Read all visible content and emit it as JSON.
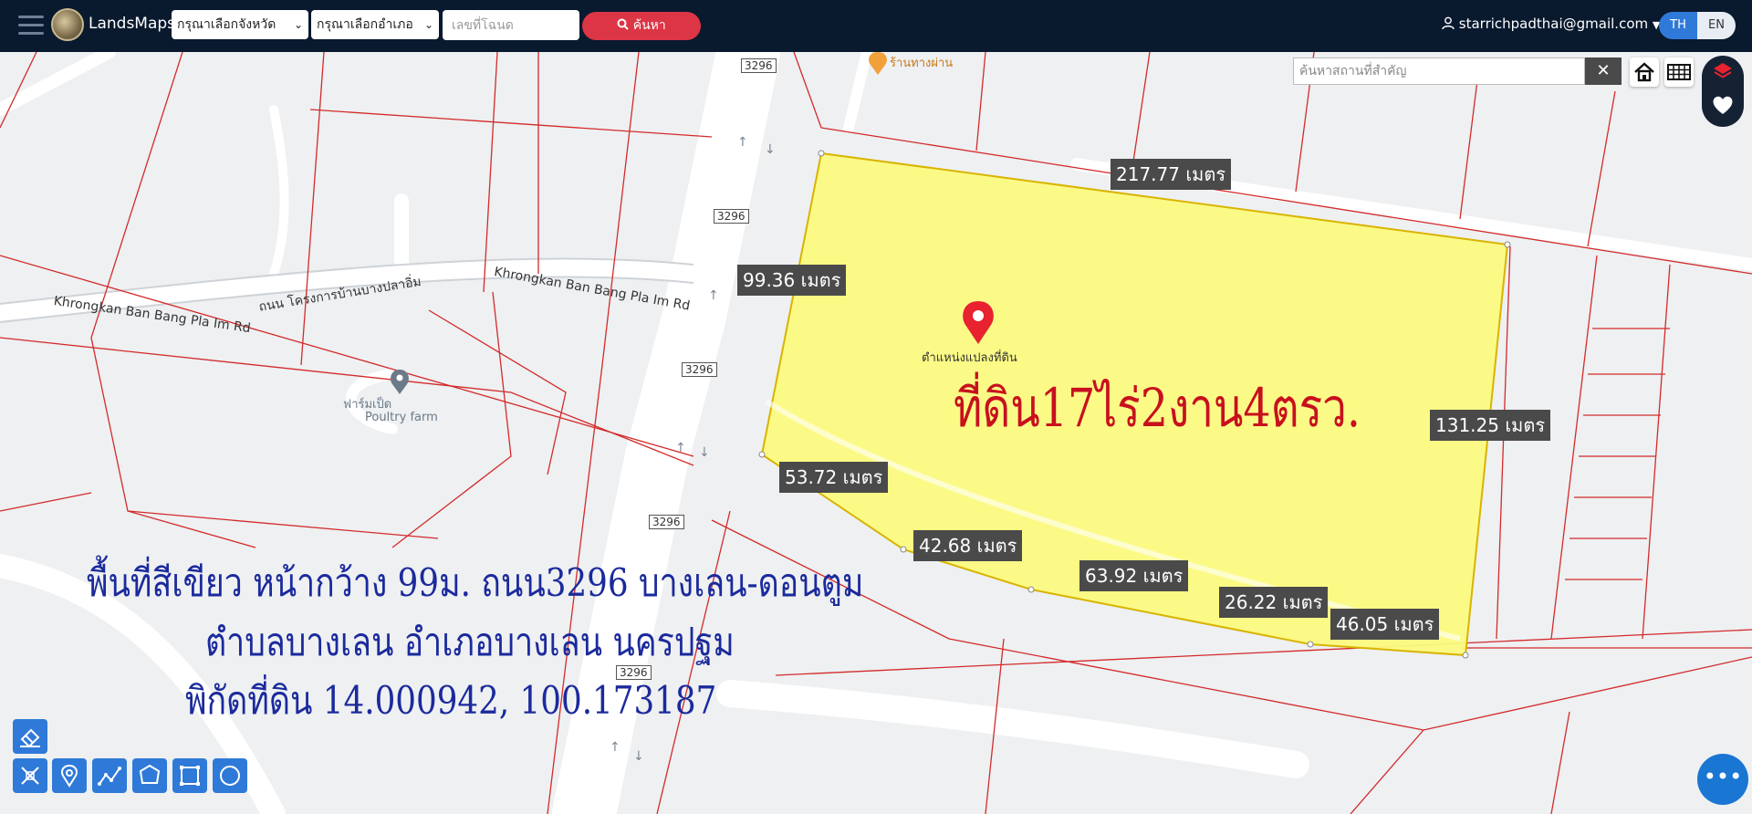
{
  "header": {
    "app_name": "LandsMaps",
    "province_select": "กรุณาเลือกจังหวัด",
    "district_select": "กรุณาเลือกอำเภอ",
    "deed_placeholder": "เลขที่โฉนด",
    "search_button": "ค้นหา",
    "user_email": "starrichpadthai@gmail.com",
    "lang_th": "TH",
    "lang_en": "EN"
  },
  "map_controls": {
    "place_search_placeholder": "ค้นหาสถานที่สำคัญ",
    "clear_label": "✕"
  },
  "map": {
    "road_shields": [
      "3296",
      "3296",
      "3296",
      "3296",
      "3296"
    ],
    "poi_shop": "ร้านทางผ่าน",
    "poi_farm_th": "ฟาร์มเป็ด",
    "poi_farm_en": "Poultry farm",
    "road_name_en_1": "Khrongkan Ban Bang Pla Im Rd",
    "road_name_th": "ถนน โครงการบ้านบางปลาอิ่ม",
    "road_name_en_2": "Khrongkan Ban Bang Pla Im Rd",
    "pin_label": "ตำแหน่งแปลงที่ดิน",
    "measurements": {
      "top": "217.77 เมตร",
      "left": "99.36 เมตร",
      "right": "131.25 เมตร",
      "b1": "53.72 เมตร",
      "b2": "42.68 เมตร",
      "b3": "63.92 เมตร",
      "b4": "26.22 เมตร",
      "b5": "46.05 เมตร"
    },
    "title_red": "ที่ดิน17ไร่2งาน4ตรว.",
    "desc_line1": "พื้นที่สีเขียว หน้ากว้าง 99ม. ถนน3296 บางเลน-ดอนตูม",
    "desc_line2": "ตำบลบางเลน อำเภอบางเลน นครปฐม",
    "desc_line3": "พิกัดที่ดิน 14.000942, 100.173187"
  },
  "colors": {
    "topbar": "#09192e",
    "parcel_fill": "#fbfa7f",
    "parcel_line": "#d9b400",
    "boundary_line": "#d42a2a",
    "red_text": "#c8101e",
    "blue_text": "#1b2a9c"
  },
  "icons": [
    "menu-icon",
    "avatar",
    "search-icon",
    "user-icon",
    "chevron-down-icon",
    "close-icon",
    "home-icon",
    "grid-icon",
    "layers-icon",
    "heart-icon",
    "map-pin-icon",
    "eraser-icon",
    "ruler-icon",
    "marker-icon",
    "polyline-icon",
    "polygon-icon",
    "rectangle-icon",
    "circle-icon",
    "more-icon"
  ]
}
